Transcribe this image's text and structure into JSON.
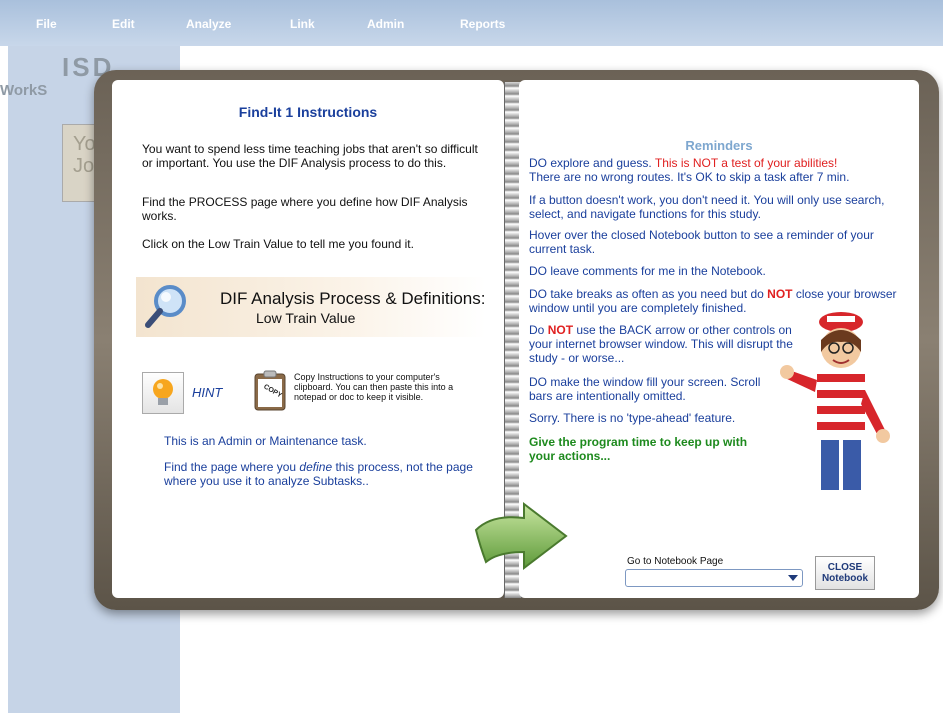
{
  "menu": {
    "items": [
      {
        "label": "File"
      },
      {
        "label": "Edit"
      },
      {
        "label": "Analyze"
      },
      {
        "label": "Link"
      },
      {
        "label": "Admin"
      },
      {
        "label": "Reports"
      }
    ]
  },
  "sidebar": {
    "logo": "ISD",
    "logo_sub": "WorkS",
    "card_text": "Yo\nJo"
  },
  "left_page": {
    "title": "Find-It 1 Instructions",
    "para1": "You want to spend less time teaching jobs that aren't so difficult or important. You use the DIF Analysis process to do this.",
    "para2": "Find the PROCESS page where you define how DIF Analysis works.",
    "para3": "Click on the Low Train Value to tell me you found it.",
    "dif_title": "DIF Analysis Process & Definitions:",
    "dif_sub": "Low Train Value",
    "hint_label": "HINT",
    "copy_text": "Copy Instructions to your computer's clipboard. You can then paste this into a notepad or doc to keep it visible.",
    "admin_note": "This is an Admin or Maintenance task.",
    "find_pre": "Find the page where you ",
    "find_em": "define",
    "find_post": " this process, not the page where you use it to analyze Subtasks.."
  },
  "right_page": {
    "title": "Reminders",
    "r1a": "DO explore and guess.  ",
    "r1b": "This is NOT a test of your abilities!",
    "r1c": "There are no wrong routes. It's OK to skip a task after 7 min.",
    "r2": "If a button doesn't work, you don't need it. You will only use search, select, and navigate functions for this study.",
    "r3": "Hover over the closed Notebook button to see a reminder of your current task.",
    "r4": "DO leave comments for me in the Notebook.",
    "r5a": "DO take breaks as often as you need but do ",
    "r5b": "NOT",
    "r5c": " close your browser window until you are completely finished.",
    "r6a": "Do ",
    "r6b": "NOT",
    "r6c": " use the BACK arrow or other controls on your internet browser window. This will disrupt the study - or worse...",
    "r7": "DO make the window fill your screen. Scroll bars are intentionally omitted.",
    "r8": "Sorry. There is no 'type-ahead' feature.",
    "r9": "Give the program time to keep up with your actions...",
    "goto_label": "Go to Notebook Page",
    "goto_value": "",
    "close_line1": "CLOSE",
    "close_line2": "Notebook"
  },
  "colors": {
    "menubar": "#b3c7e0",
    "sidebar": "#c6d4e7",
    "title_blue": "#1a3f9c",
    "reminder_red": "#e02020",
    "reminder_green": "#1e8a1e"
  },
  "icons": [
    "magnifier-icon",
    "lightbulb-icon",
    "clipboard-copy-icon",
    "next-arrow-icon",
    "dropdown-arrow-icon",
    "waldo-illustration"
  ]
}
